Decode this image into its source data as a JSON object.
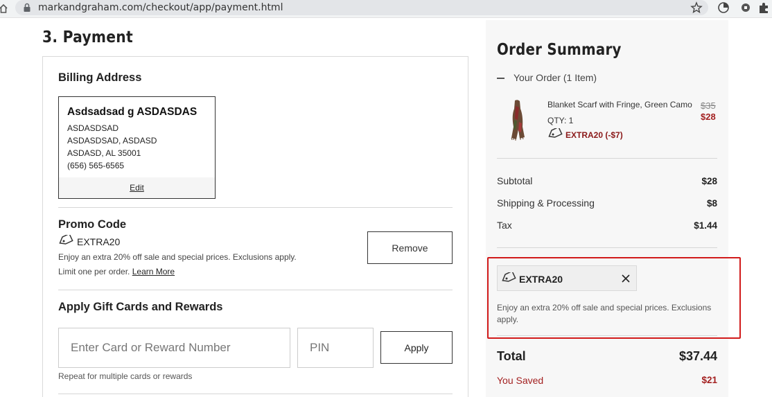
{
  "browser": {
    "url": "markandgraham.com/checkout/app/payment.html"
  },
  "page": {
    "title": "3. Payment"
  },
  "billing": {
    "heading": "Billing Address",
    "name": "Asdsadsad g ASDASDAS",
    "lines": [
      "ASDASDSAD",
      "ASDASDSAD, ASDASD",
      "ASDASD, AL 35001",
      "(656) 565-6565"
    ],
    "edit_label": "Edit"
  },
  "promo": {
    "heading": "Promo Code",
    "code": "EXTRA20",
    "description": "Enjoy an extra 20% off sale and special prices. Exclusions apply.",
    "limit_text": "Limit one per order.",
    "learn_more": "Learn More",
    "remove_label": "Remove"
  },
  "gift": {
    "heading": "Apply Gift Cards and Rewards",
    "card_placeholder": "Enter Card or Reward Number",
    "pin_placeholder": "PIN",
    "apply_label": "Apply",
    "hint": "Repeat for multiple cards or rewards"
  },
  "summary": {
    "title": "Order Summary",
    "order_label": "Your Order (1 Item)",
    "item": {
      "name": "Blanket Scarf with Fringe, Green Camo",
      "qty": "QTY: 1",
      "price_original": "$35",
      "price_sale": "$28",
      "promo": "EXTRA20 (-$7)"
    },
    "rows": [
      {
        "label": "Subtotal",
        "value": "$28"
      },
      {
        "label": "Shipping & Processing",
        "value": "$8"
      },
      {
        "label": "Tax",
        "value": "$1.44"
      }
    ],
    "applied_code": "EXTRA20",
    "applied_description": "Enjoy an extra 20% off sale and special prices. Exclusions apply.",
    "total_label": "Total",
    "total_value": "$37.44",
    "saved_label": "You Saved",
    "saved_value": "$21"
  },
  "colors": {
    "sale_red": "#a32020",
    "highlight": "#d11a1a",
    "summary_bg": "#f7f7f7"
  }
}
